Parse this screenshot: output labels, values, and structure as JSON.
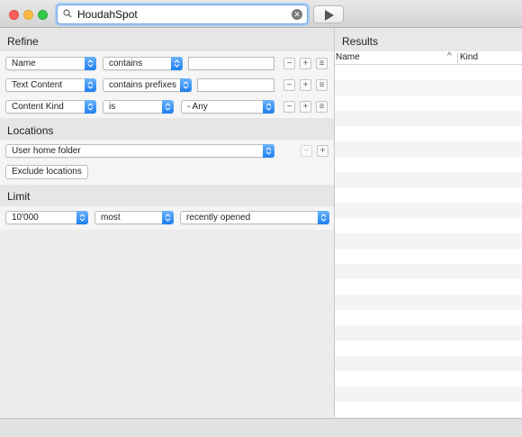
{
  "toolbar": {
    "search_value": "HoudahSpot",
    "search_icon": "magnifier-icon",
    "clear_icon": "clear-icon",
    "run_icon": "play-icon"
  },
  "refine": {
    "title": "Refine",
    "criteria": [
      {
        "attribute": "Name",
        "operator": "contains",
        "value": ""
      },
      {
        "attribute": "Text Content",
        "operator": "contains prefixes",
        "value": ""
      },
      {
        "attribute": "Content Kind",
        "operator": "is",
        "value": "- Any"
      }
    ],
    "remove_glyph": "−",
    "add_glyph": "+",
    "group_glyph": "≡"
  },
  "locations": {
    "title": "Locations",
    "selected": "User home folder",
    "remove_glyph": "−",
    "add_glyph": "+",
    "exclude_button": "Exclude locations"
  },
  "limit": {
    "title": "Limit",
    "count": "10'000",
    "order": "most",
    "sort_by": "recently opened"
  },
  "results": {
    "title": "Results",
    "columns": [
      {
        "label": "Name",
        "sort": "ascending"
      },
      {
        "label": "Kind"
      }
    ],
    "sort_indicator": "^"
  },
  "colors": {
    "accent": "#1d7ff0",
    "window_bg": "#ececec",
    "traffic_red": "#fc605b",
    "traffic_yellow": "#fdbc40",
    "traffic_green": "#34c84a"
  }
}
